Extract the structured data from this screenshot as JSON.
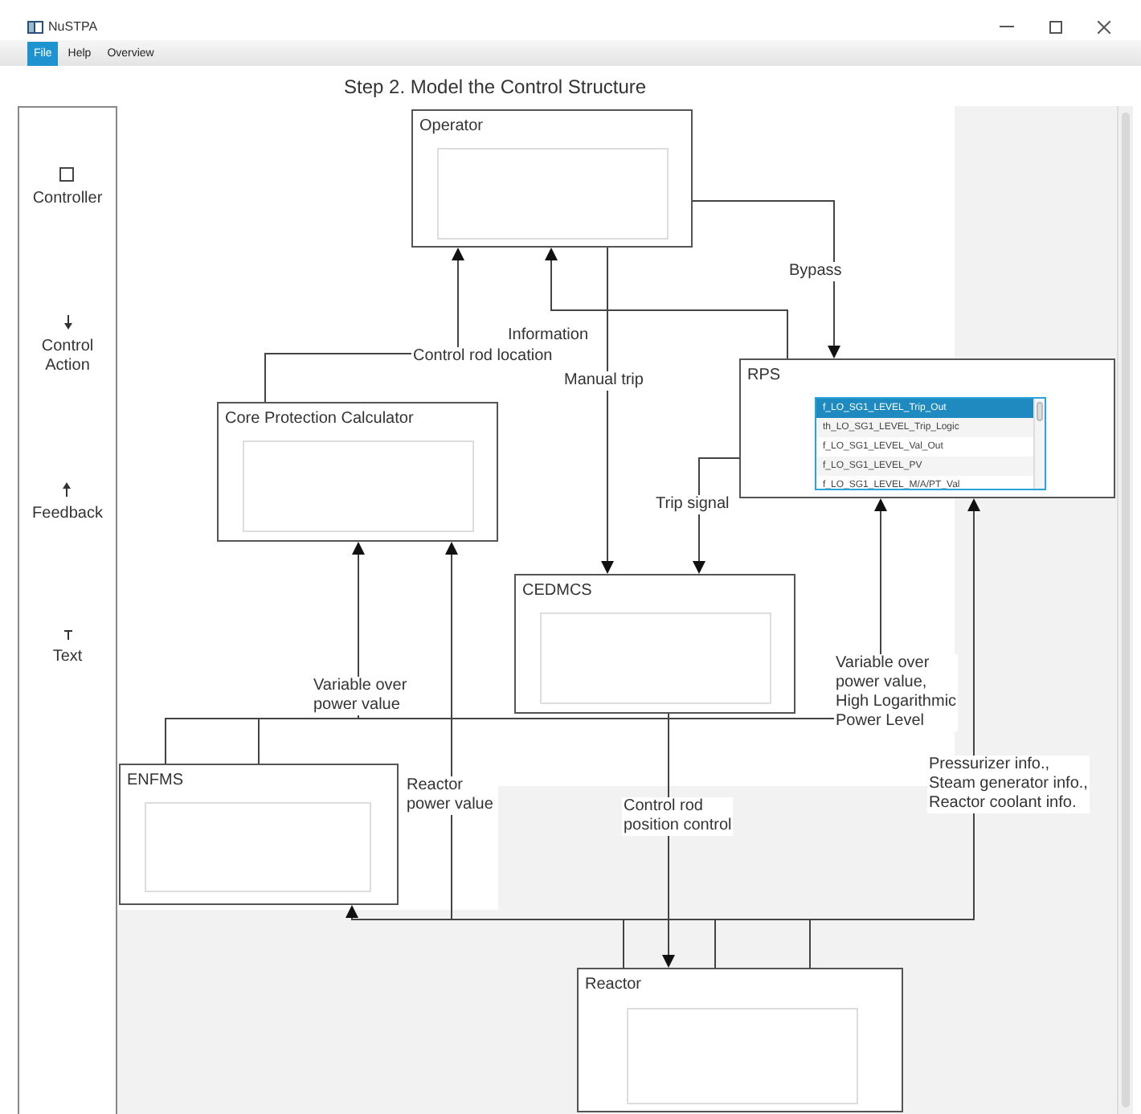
{
  "window": {
    "title": "NuSTPA"
  },
  "menu": [
    {
      "label": "File",
      "selected": true
    },
    {
      "label": "Help",
      "selected": false
    },
    {
      "label": "Overview",
      "selected": false
    }
  ],
  "heading": "Step 2. Model the Control Structure",
  "palette": [
    {
      "kind": "controller",
      "label": "Controller"
    },
    {
      "kind": "control_action",
      "label": "Control\nAction"
    },
    {
      "kind": "feedback",
      "label": "Feedback"
    },
    {
      "kind": "text",
      "label": "Text"
    }
  ],
  "nodes": [
    {
      "title": "Operator"
    },
    {
      "title": "RPS",
      "list": [
        {
          "label": "f_LO_SG1_LEVEL_Trip_Out",
          "selected": true
        },
        {
          "label": "th_LO_SG1_LEVEL_Trip_Logic",
          "selected": false
        },
        {
          "label": "f_LO_SG1_LEVEL_Val_Out",
          "selected": false
        },
        {
          "label": "f_LO_SG1_LEVEL_PV",
          "selected": false
        },
        {
          "label": "f_LO_SG1_LEVEL_M/A/PT_Val",
          "selected": false
        }
      ]
    },
    {
      "title": "Core Protection Calculator"
    },
    {
      "title": "CEDMCS"
    },
    {
      "title": "ENFMS"
    },
    {
      "title": "Reactor"
    }
  ],
  "edges": [
    {
      "label": "Bypass"
    },
    {
      "label": "Information"
    },
    {
      "label": "Control rod location"
    },
    {
      "label": "Manual trip"
    },
    {
      "label": "Trip signal"
    },
    {
      "label": "Variable over\npower value"
    },
    {
      "label": "Variable over\npower value,\nHigh Logarithmic\nPower Level"
    },
    {
      "label": "Reactor\npower value"
    },
    {
      "label": "Control rod\nposition control"
    },
    {
      "label": "Pressurizer info.,\nSteam generator info.,\nReactor coolant info."
    }
  ]
}
